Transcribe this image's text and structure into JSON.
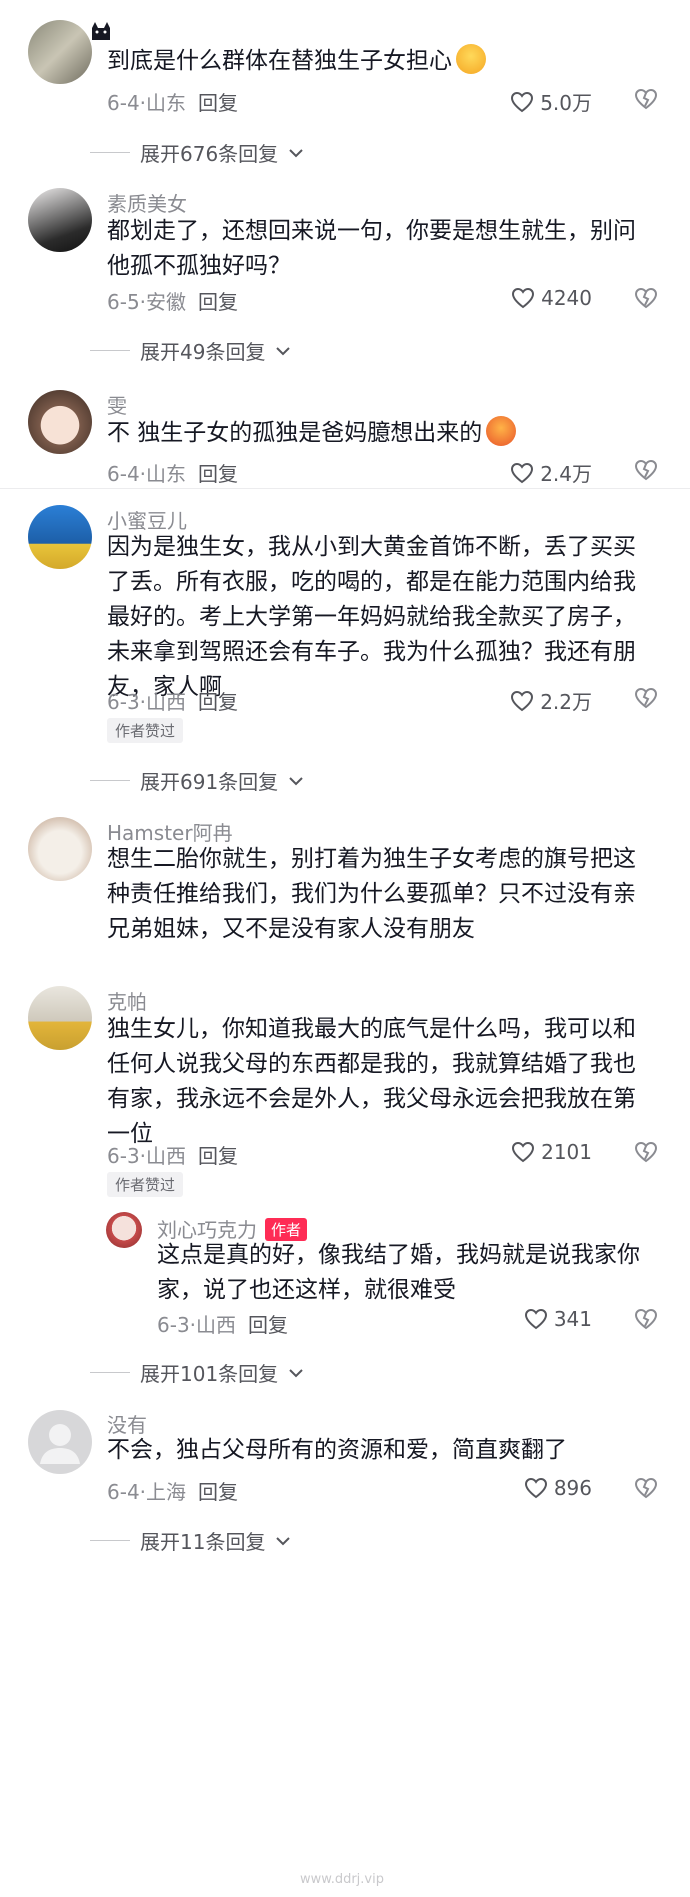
{
  "comments": [
    {
      "user": "",
      "text": "到底是什么群体在替独生子女担心",
      "date": "6-4",
      "location": "山东",
      "reply_label": "回复",
      "likes": "5.0万"
    },
    {
      "user": "素质美女",
      "text": "都划走了，还想回来说一句，你要是想生就生，别问他孤不孤独好吗？",
      "date": "6-5",
      "location": "安徽",
      "reply_label": "回复",
      "likes": "4240"
    },
    {
      "user": "雯",
      "text": "不 独生子女的孤独是爸妈臆想出来的",
      "date": "6-4",
      "location": "山东",
      "reply_label": "回复",
      "likes": "2.4万"
    },
    {
      "user": "小蜜豆儿",
      "text": "因为是独生女，我从小到大黄金首饰不断，丢了买买了丢。所有衣服，吃的喝的，都是在能力范围内给我最好的。考上大学第一年妈妈就给我全款买了房子，未来拿到驾照还会有车子。我为什么孤独？我还有朋友，家人啊",
      "date": "6-3",
      "location": "山西",
      "reply_label": "回复",
      "likes": "2.2万",
      "badge": "作者赞过"
    },
    {
      "user": "Hamster阿冉",
      "text": "想生二胎你就生，别打着为独生子女考虑的旗号把这种责任推给我们，我们为什么要孤单？只不过没有亲兄弟姐妹，又不是没有家人没有朋友"
    },
    {
      "user": "克帕",
      "text": "独生女儿，你知道我最大的底气是什么吗，我可以和任何人说我父母的东西都是我的，我就算结婚了我也有家，我永远不会是外人，我父母永远会把我放在第一位",
      "date": "6-3",
      "location": "山西",
      "reply_label": "回复",
      "likes": "2101",
      "badge": "作者赞过"
    },
    {
      "user": "刘心巧克力",
      "author_tag": "作者",
      "text": "这点是真的好，像我结了婚，我妈就是说我家你家，说了也还这样，就很难受",
      "date": "6-3",
      "location": "山西",
      "reply_label": "回复",
      "likes": "341"
    },
    {
      "user": "没有",
      "text": "不会，独占父母所有的资源和爱，简直爽翻了",
      "date": "6-4",
      "location": "上海",
      "reply_label": "回复",
      "likes": "896"
    }
  ],
  "expanders": [
    "展开676条回复",
    "展开49条回复",
    "展开691条回复",
    "展开101条回复",
    "展开11条回复"
  ],
  "dot_sep": "·",
  "watermark": "www.ddrj.vip",
  "colors": {
    "author_tag": "#fe2c55",
    "meta": "#8a8b91",
    "text": "#161823"
  }
}
